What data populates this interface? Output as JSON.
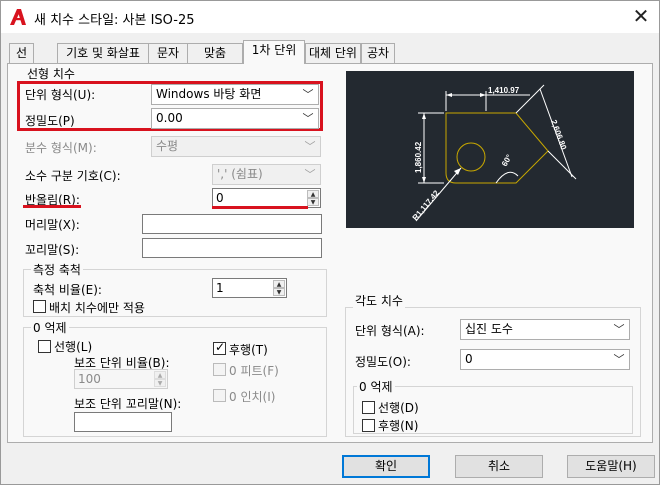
{
  "window": {
    "title": "새 치수 스타일: 사본 ISO-25",
    "close": "✕"
  },
  "tabs": [
    "선",
    "기호 및 화살표",
    "문자",
    "맞춤",
    "1차 단위",
    "대체 단위",
    "공차"
  ],
  "linear": {
    "group_title": "선형 치수",
    "unit_format_label": "단위 형식(U):",
    "unit_format_value": "Windows 바탕 화면",
    "precision_label": "정밀도(P)",
    "precision_value": "0.00",
    "fraction_label": "분수 형식(M):",
    "fraction_value": "수평",
    "decimal_sep_label": "소수 구분 기호(C):",
    "decimal_sep_value": "','  (쉼표)",
    "roundoff_label": "반올림(R):",
    "roundoff_value": "0",
    "prefix_label": "머리말(X):",
    "suffix_label": "꼬리말(S):"
  },
  "scale": {
    "group_title": "측정 축척",
    "factor_label": "축척 비율(E):",
    "factor_value": "1",
    "layout_only": "배치 치수에만 적용"
  },
  "zero_suppression": {
    "group_title": "0 억제",
    "leading": "선행(L)",
    "trailing": "후행(T)",
    "sub_factor_label": "보조 단위 비율(B):",
    "sub_factor_value": "100",
    "feet": "0 피트(F)",
    "inches": "0 인치(I)",
    "sub_suffix_label": "보조 단위 꼬리말(N):"
  },
  "preview": {
    "dim_top": "1,410.97",
    "dim_left": "1,860.42",
    "dim_right": "2,606.80",
    "dim_angle": "60°",
    "dim_radius": "R1,117.42"
  },
  "angular": {
    "group_title": "각도 치수",
    "unit_format_label": "단위 형식(A):",
    "unit_format_value": "십진 도수",
    "precision_label": "정밀도(O):",
    "precision_value": "0",
    "zero_title": "0 억제",
    "leading": "선행(D)",
    "trailing": "후행(N)"
  },
  "buttons": {
    "ok": "확인",
    "cancel": "취소",
    "help": "도움말(H)"
  },
  "colors": {
    "highlight": "#d8121e",
    "preview_bg": "#232930",
    "preview_line": "#ffffff",
    "preview_shape": "#c8a800"
  }
}
